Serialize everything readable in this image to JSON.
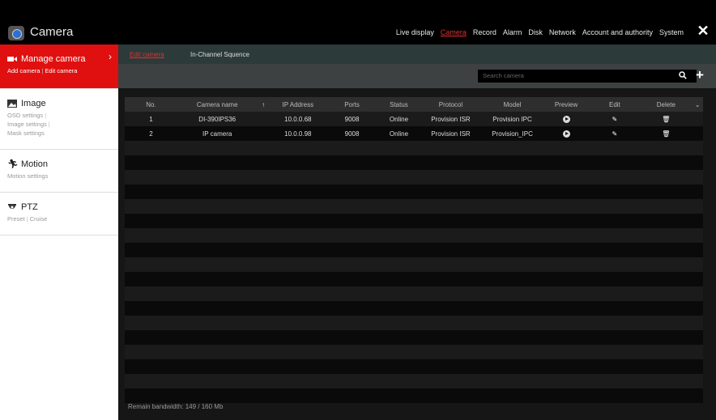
{
  "app": {
    "title": "Camera"
  },
  "topnav": [
    "Live display",
    "Camera",
    "Record",
    "Alarm",
    "Disk",
    "Network",
    "Account and authority",
    "System"
  ],
  "sidebar": {
    "sections": [
      {
        "title": "Manage camera",
        "links": [
          "Add camera",
          "Edit camera"
        ]
      },
      {
        "title": "Image",
        "links": [
          "OSD settings",
          "Image settings",
          "Mask settings"
        ]
      },
      {
        "title": "Motion",
        "links": [
          "Motion settings"
        ]
      },
      {
        "title": "PTZ",
        "links": [
          "Preset",
          "Cruise"
        ]
      }
    ]
  },
  "tabs": [
    "Edit camera",
    "In-Channel Squence"
  ],
  "search": {
    "placeholder": "Search camera"
  },
  "table": {
    "headers": [
      "No.",
      "Camera name",
      "IP Address",
      "Ports",
      "Status",
      "Protocol",
      "Model",
      "Preview",
      "Edit",
      "Delete"
    ],
    "rows": [
      {
        "no": "1",
        "name": "DI-390IPS36",
        "ip": "10.0.0.68",
        "port": "9008",
        "status": "Online",
        "protocol": "Provision ISR",
        "model": "Provision IPC"
      },
      {
        "no": "2",
        "name": "IP camera",
        "ip": "10.0.0.98",
        "port": "9008",
        "status": "Online",
        "protocol": "Provision ISR",
        "model": "Provision_IPC"
      }
    ]
  },
  "footer": {
    "bandwidth": "Remain bandwidth: 149 / 160 Mb"
  },
  "colors": {
    "accent": "#e01010",
    "toolbar": "#3d4141",
    "tabs": "#2c3a3a"
  }
}
